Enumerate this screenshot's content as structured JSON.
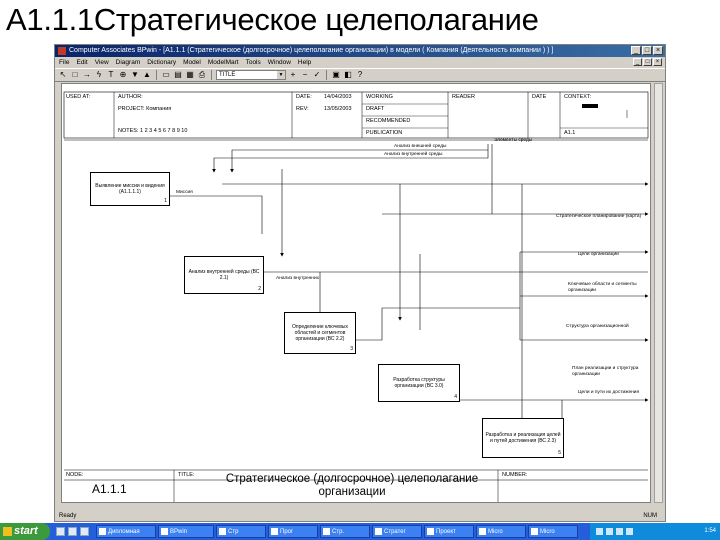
{
  "slide_title": "A1.1.1Стратегическое целеполагание",
  "window": {
    "title": "Computer Associates BPwin - [A1.1.1 (Стратегическое (долгосрочное) целеполагание организации) в модели ( Компания (Деятельность компании ) ) ]",
    "controls": [
      "_",
      "□",
      "×"
    ],
    "mdi_controls": [
      "_",
      "□",
      "×"
    ]
  },
  "menu": [
    "File",
    "Edit",
    "View",
    "Diagram",
    "Dictionary",
    "Model",
    "ModelMart",
    "Tools",
    "Window",
    "Help"
  ],
  "toolbar": {
    "tools": [
      "arrow-select-icon",
      "box-tool-icon",
      "arrow-tool-icon",
      "squiggle-icon",
      "text-tool-icon",
      "diagram-nav-icon",
      "go-to-child-icon",
      "go-to-parent-icon"
    ],
    "combo_value": "TITLE"
  },
  "header": {
    "used_at_label": "USED AT:",
    "author_label": "AUTHOR:",
    "project_label": "PROJECT: Компания",
    "date_label": "DATE:",
    "date_value": "14/04/2003",
    "rev_label": "REV:",
    "rev_value": "13/05/2003",
    "notes_label": "NOTES: 1 2 3 4 5 6 7 8 9 10",
    "working_label": "WORKING",
    "draft_label": "DRAFT",
    "recommended_label": "RECOMMENDED",
    "publication_label": "PUBLICATION",
    "reader_label": "READER",
    "date2_label": "DATE",
    "context_label": "CONTEXT:",
    "a11_label": "A1.1"
  },
  "diagram": {
    "boxes": [
      {
        "text": "Выявление миссии и видения (A1.1.1.1)",
        "num": "1"
      },
      {
        "text": "Анализ внутренней среды (ВС 2.1)",
        "num": "2"
      },
      {
        "text": "Определение ключевых областей и сегментов организации (ВС 2.2)",
        "num": "3"
      },
      {
        "text": "Разработка структуры организации (ВС 3.0)",
        "num": "4"
      },
      {
        "text": "Разработка и реализация целей и путей достижения (ВС 2.3)",
        "num": "5"
      }
    ],
    "labels": {
      "external_env": "Анализ внешней среды",
      "internal_env": "Анализ внутренней среды",
      "events": "Элементы среды",
      "mission": "Миссия",
      "internal_analysis": "Анализ внутренних",
      "strategy_org": "Стратегическое планирование (карта)",
      "targets": "Цели организации",
      "key_areas": "Ключевые области и сегменты организации",
      "structure": "Структура организационной",
      "achievement": "Цели и пути их достижения",
      "impl": "План реализации и структура организации"
    }
  },
  "footer": {
    "node_label": "NODE:",
    "node_value": "A1.1.1",
    "title_label": "TITLE:",
    "title_value": "Стратегическое (долгосрочное) целеполагание организации",
    "number_label": "NUMBER:"
  },
  "status": {
    "ready": "Ready",
    "num": "NUM"
  },
  "taskbar": {
    "start": "start",
    "tasks": [
      "Дипломная",
      "BPwin",
      "Стр",
      "Прог",
      "Стр.",
      "Стратег",
      "Проект",
      "Micro",
      "Micro"
    ],
    "clock": "1:54"
  }
}
